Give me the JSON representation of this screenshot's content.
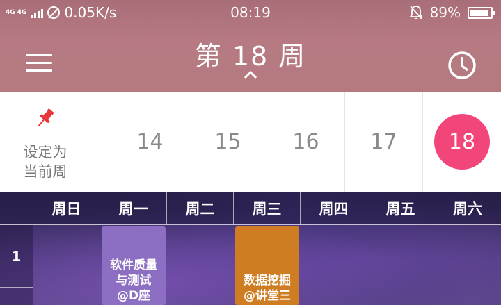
{
  "status_bar": {
    "network": "4G 4G",
    "speed": "0.05K/s",
    "time": "08:19",
    "battery": "89%",
    "battery_level": 0.89
  },
  "header": {
    "week_title": "第 18 周"
  },
  "week_selector": {
    "pin_label_line1": "设定为",
    "pin_label_line2": "当前周",
    "weeks": [
      "14",
      "15",
      "16",
      "17",
      "18"
    ],
    "selected_week": "18",
    "selected_color": "#f2467a"
  },
  "timetable": {
    "days": [
      "周日",
      "周一",
      "周二",
      "周三",
      "周四",
      "周五",
      "周六"
    ],
    "periods": [
      "1"
    ],
    "courses": [
      {
        "text": "软件质量与测试@D座",
        "day": "周一",
        "color": "#8c6fc2"
      },
      {
        "text": "数据挖掘@讲堂三",
        "day": "周三",
        "color": "#cf7d22"
      }
    ]
  }
}
